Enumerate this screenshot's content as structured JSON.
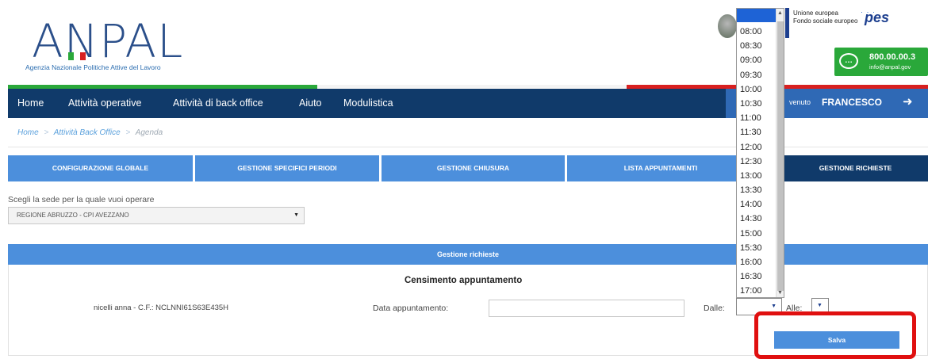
{
  "brand": {
    "logo": "ANPAL",
    "subtitle": "Agenzia Nazionale Politiche Attive del Lavoro",
    "colors": {
      "primary": "#103a6a",
      "accent": "#4c8fdc",
      "green": "#2aa83a",
      "red": "#d82020"
    }
  },
  "header_right": {
    "eu_line1": "Unione europea",
    "eu_line2": "Fondo sociale europeo",
    "pes": "pes",
    "phone": "800.00.00.3",
    "email": "info@anpal.gov"
  },
  "nav": {
    "items": [
      "Home",
      "Attività operative",
      "Attività di back office",
      "Aiuto",
      "Modulistica"
    ],
    "welcome": "venuto",
    "user": "FRANCESCO",
    "logout_icon": "logout-icon"
  },
  "breadcrumb": {
    "items": [
      "Home",
      "Attività Back Office",
      "Agenda"
    ],
    "separator": ">"
  },
  "tabs": [
    "CONFIGURAZIONE GLOBALE",
    "GESTIONE SPECIFICI PERIODI",
    "GESTIONE CHIUSURA",
    "LISTA APPUNTAMENTI",
    "",
    "GESTIONE RICHIESTE"
  ],
  "sede": {
    "label": "Scegli la sede per la quale vuoi operare",
    "selected": "REGIONE ABRUZZO - CPI AVEZZANO"
  },
  "panel": {
    "title": "Gestione richieste",
    "subtitle": "Censimento appuntamento",
    "persona": "nicelli anna - C.F.: NCLNNI61S63E435H",
    "data_label": "Data appuntamento:",
    "data_value": "",
    "dalle_label": "Dalle:",
    "alle_label": "Alle:",
    "salva": "Salva"
  },
  "time_options": [
    "08:00",
    "08:30",
    "09:00",
    "09:30",
    "10:00",
    "10:30",
    "11:00",
    "11:30",
    "12:00",
    "12:30",
    "13:00",
    "13:30",
    "14:00",
    "14:30",
    "15:00",
    "15:30",
    "16:00",
    "16:30",
    "17:00"
  ]
}
